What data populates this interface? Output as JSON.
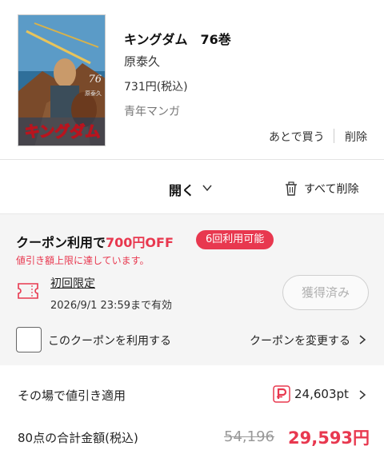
{
  "item": {
    "title": "キングダム　76巻",
    "author": "原泰久",
    "price": "731円(税込)",
    "genre": "青年マンガ",
    "later_label": "あとで買う",
    "delete_label": "削除",
    "cover": {
      "logo_text": "キングダム",
      "volume": "76",
      "author_text": "原泰久"
    }
  },
  "actions": {
    "open_label": "開く",
    "delete_all_label": "すべて削除"
  },
  "coupon": {
    "heading_prefix": "クーポン利用で",
    "heading_amount": "700円OFF",
    "badge": "6回利用可能",
    "limit_note": "値引き額上限に達しています。",
    "first_time": "初回限定",
    "expiry": "2026/9/1 23:59まで有効",
    "acquired_label": "獲得済み",
    "use_label": "このクーポンを利用する",
    "use_checked": false,
    "change_label": "クーポンを変更する"
  },
  "discount": {
    "label": "その場で値引き適用",
    "points": "24,603pt"
  },
  "total": {
    "label": "80点の合計金額(税込)",
    "original": "54,196",
    "final": "29,593円"
  },
  "colors": {
    "accent": "#e8384f",
    "muted": "#999999",
    "panel_bg": "#f5f5f5"
  }
}
